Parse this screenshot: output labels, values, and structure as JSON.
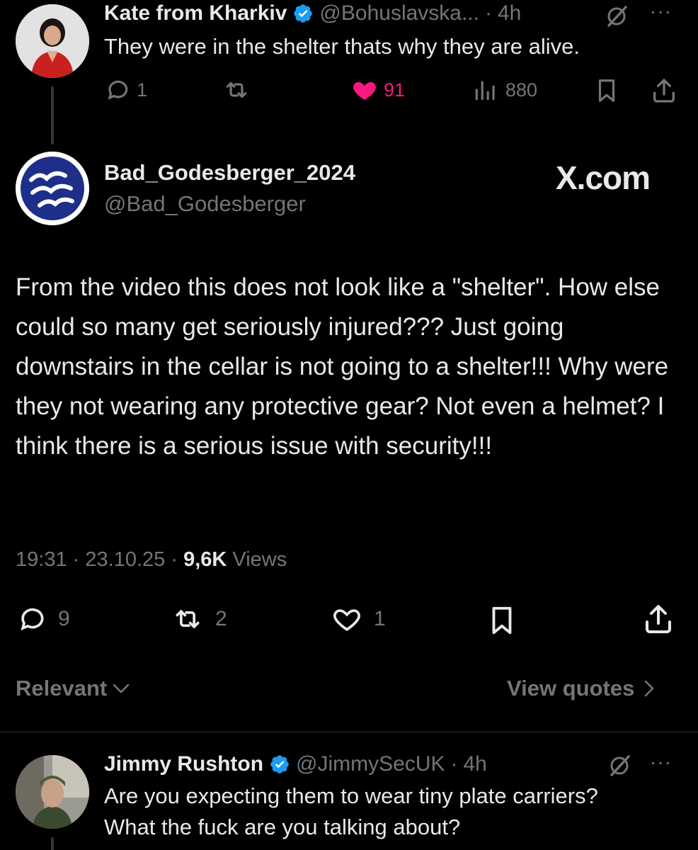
{
  "reply_top": {
    "display_name": "Kate from Kharkiv",
    "handle": "@Bohuslavska...",
    "time_sep": "·",
    "time": "4h",
    "more": "···",
    "text": "They were in the shelter thats why they are alive.",
    "replies": "1",
    "likes": "91",
    "views": "880"
  },
  "main_tweet": {
    "display_name": "Bad_Godesberger_2024",
    "handle": "@Bad_Godesberger",
    "watermark": "X.com",
    "text": "From the video this does not look like a \"shelter\". How else could so many get seriously injured??? Just going downstairs in the cellar is not going to a shelter!!! Why were they not wearing any protective gear? Not even a helmet? I think there is a serious issue with security!!!",
    "time": "19:31",
    "date": "23.10.25",
    "sep": "·",
    "views_count": "9,6K",
    "views_label": "Views",
    "replies": "9",
    "reposts": "2",
    "likes": "1"
  },
  "sort_bar": {
    "relevant_label": "Relevant",
    "view_quotes_label": "View quotes"
  },
  "reply_bottom": {
    "display_name": "Jimmy Rushton",
    "handle": "@JimmySecUK",
    "time_sep": "·",
    "time": "4h",
    "more": "···",
    "text_line1": "Are you expecting them to wear tiny plate carriers?",
    "text_line2": "What the fuck are you talking about?"
  },
  "colors": {
    "background": "#000000",
    "text": "#e7e9ea",
    "secondary": "#71767b",
    "like_pink": "#f91880",
    "verified_blue": "#1d9bf0",
    "divider": "#2f3336"
  },
  "icons": [
    "reply-icon",
    "repost-icon",
    "like-icon",
    "views-icon",
    "bookmark-icon",
    "share-icon",
    "grok-icon",
    "more-icon",
    "verified-badge-icon",
    "chevron-down-icon",
    "chevron-right-icon"
  ]
}
